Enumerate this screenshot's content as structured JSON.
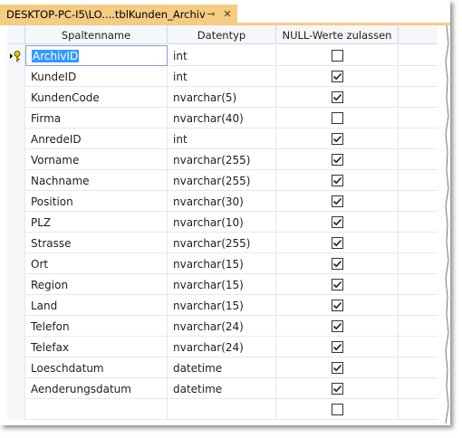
{
  "tab": {
    "title": "DESKTOP-PC-I5\\LO....tblKunden_Archiv",
    "pin_glyph": "⊸",
    "close_glyph": "✕"
  },
  "columns": [
    "Spaltenname",
    "Datentyp",
    "NULL-Werte zulassen"
  ],
  "rows": [
    {
      "name": "ArchivID",
      "type": "int",
      "nullable": false,
      "primary_key": true,
      "selected": true
    },
    {
      "name": "KundeID",
      "type": "int",
      "nullable": true
    },
    {
      "name": "KundenCode",
      "type": "nvarchar(5)",
      "nullable": true
    },
    {
      "name": "Firma",
      "type": "nvarchar(40)",
      "nullable": false
    },
    {
      "name": "AnredeID",
      "type": "int",
      "nullable": true
    },
    {
      "name": "Vorname",
      "type": "nvarchar(255)",
      "nullable": true
    },
    {
      "name": "Nachname",
      "type": "nvarchar(255)",
      "nullable": true
    },
    {
      "name": "Position",
      "type": "nvarchar(30)",
      "nullable": true
    },
    {
      "name": "PLZ",
      "type": "nvarchar(10)",
      "nullable": true
    },
    {
      "name": "Strasse",
      "type": "nvarchar(255)",
      "nullable": true
    },
    {
      "name": "Ort",
      "type": "nvarchar(15)",
      "nullable": true
    },
    {
      "name": "Region",
      "type": "nvarchar(15)",
      "nullable": true
    },
    {
      "name": "Land",
      "type": "nvarchar(15)",
      "nullable": true
    },
    {
      "name": "Telefon",
      "type": "nvarchar(24)",
      "nullable": true
    },
    {
      "name": "Telefax",
      "type": "nvarchar(24)",
      "nullable": true
    },
    {
      "name": "Loeschdatum",
      "type": "datetime",
      "nullable": true
    },
    {
      "name": "Aenderungsdatum",
      "type": "datetime",
      "nullable": true
    },
    {
      "name": "",
      "type": "",
      "nullable": false
    }
  ],
  "colors": {
    "tab": "#f5cc84",
    "selection": "#3399ff",
    "header": "#f6f7fb"
  }
}
